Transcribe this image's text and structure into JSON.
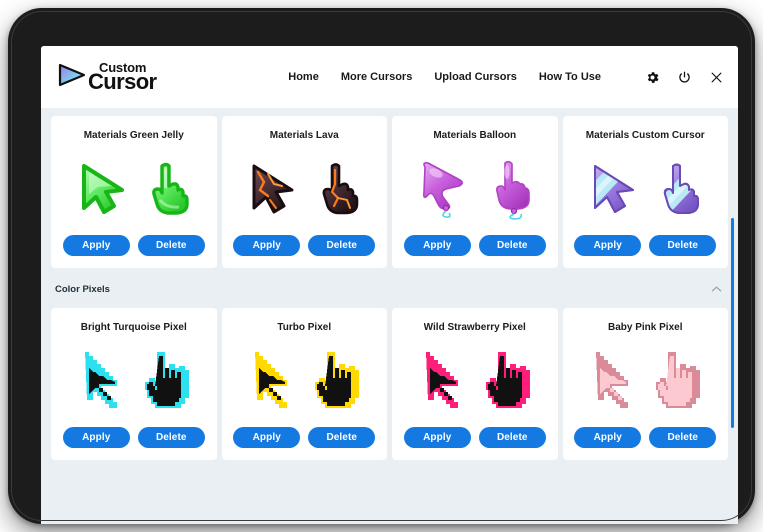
{
  "brand": {
    "top_word": "Custom",
    "bottom_word": "Cursor",
    "logo_icon": "cursor-arrow-gradient-icon",
    "gradient_from": "#8f6fe0",
    "gradient_to": "#6fd8f5"
  },
  "nav": {
    "links": [
      {
        "label": "Home",
        "name": "nav-link-home"
      },
      {
        "label": "More Cursors",
        "name": "nav-link-more-cursors"
      },
      {
        "label": "Upload Cursors",
        "name": "nav-link-upload-cursors"
      },
      {
        "label": "How To Use",
        "name": "nav-link-how-to-use"
      }
    ],
    "icons": [
      {
        "name": "gear-icon",
        "label": "Settings"
      },
      {
        "name": "power-icon",
        "label": "Power"
      },
      {
        "name": "close-icon",
        "label": "Close"
      }
    ]
  },
  "theme": {
    "accent": "#1479e0",
    "page_bg": "#e9eff3",
    "card_bg": "#ffffff",
    "frame": "#1c1c1c",
    "text": "#1c1c1c"
  },
  "buttons": {
    "apply_label": "Apply",
    "delete_label": "Delete"
  },
  "rows": [
    {
      "section": null,
      "cards": [
        {
          "title": "Materials Green Jelly",
          "style": "jelly",
          "colors": {
            "base": "#3fe03f",
            "light": "#a8f5a8",
            "dark": "#17b517"
          }
        },
        {
          "title": "Materials Lava",
          "style": "lava",
          "colors": {
            "base": "#4a3338",
            "light": "#6a4a4e",
            "dark": "#2a1c20",
            "accent": "#ff7a18"
          }
        },
        {
          "title": "Materials Balloon",
          "style": "balloon",
          "colors": {
            "base": "#c555dd",
            "light": "#e6a6f0",
            "dark": "#a83cc0",
            "accent": "#45d4f5"
          }
        },
        {
          "title": "Materials Custom Cursor",
          "style": "ribbon",
          "colors": {
            "base": "#9a7ae0",
            "light": "#c2b0f0",
            "dark": "#7a5ac8",
            "accent": "#9fe3f5"
          }
        }
      ]
    },
    {
      "section": {
        "title": "Color Pixels",
        "chevron": "chevron-up-icon",
        "expanded": true
      },
      "cards": [
        {
          "title": "Bright Turquoise Pixel",
          "style": "pixel",
          "colors": {
            "outline": "#2de0f0",
            "fill": "#111111"
          }
        },
        {
          "title": "Turbo Pixel",
          "style": "pixel",
          "colors": {
            "outline": "#ffd900",
            "fill": "#111111"
          }
        },
        {
          "title": "Wild Strawberry Pixel",
          "style": "pixel",
          "colors": {
            "outline": "#ff1f7a",
            "fill": "#111111"
          }
        },
        {
          "title": "Baby Pink Pixel",
          "style": "pixel",
          "colors": {
            "outline": "#d98b98",
            "fill": "#fbc9cf"
          }
        }
      ]
    }
  ],
  "scrollbar": {
    "name": "vertical-scrollbar",
    "color": "#1479e0"
  }
}
